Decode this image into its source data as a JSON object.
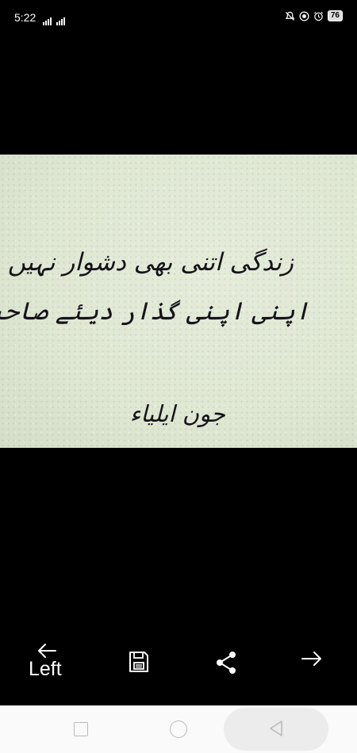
{
  "status_bar": {
    "time": "5:22",
    "battery": "76",
    "icons": [
      "signal-icon",
      "signal-icon",
      "mute-icon",
      "data-icon",
      "alarm-icon",
      "battery-icon"
    ]
  },
  "image": {
    "line_1": "زندگی اتنی بھی دشوار نہیں",
    "line_2": "اپنی اپنی گذار دیئے صاحب ۔",
    "author": "جون ایلیاء",
    "background_color": "#dfe8d3",
    "text_color": "#16131a"
  },
  "action_bar": {
    "left_label": "Left",
    "icons": [
      "left-arrow-icon",
      "save-icon",
      "share-icon",
      "right-arrow-icon"
    ]
  },
  "nav_bar": {
    "icons": [
      "recents-icon",
      "home-icon",
      "back-icon"
    ]
  }
}
